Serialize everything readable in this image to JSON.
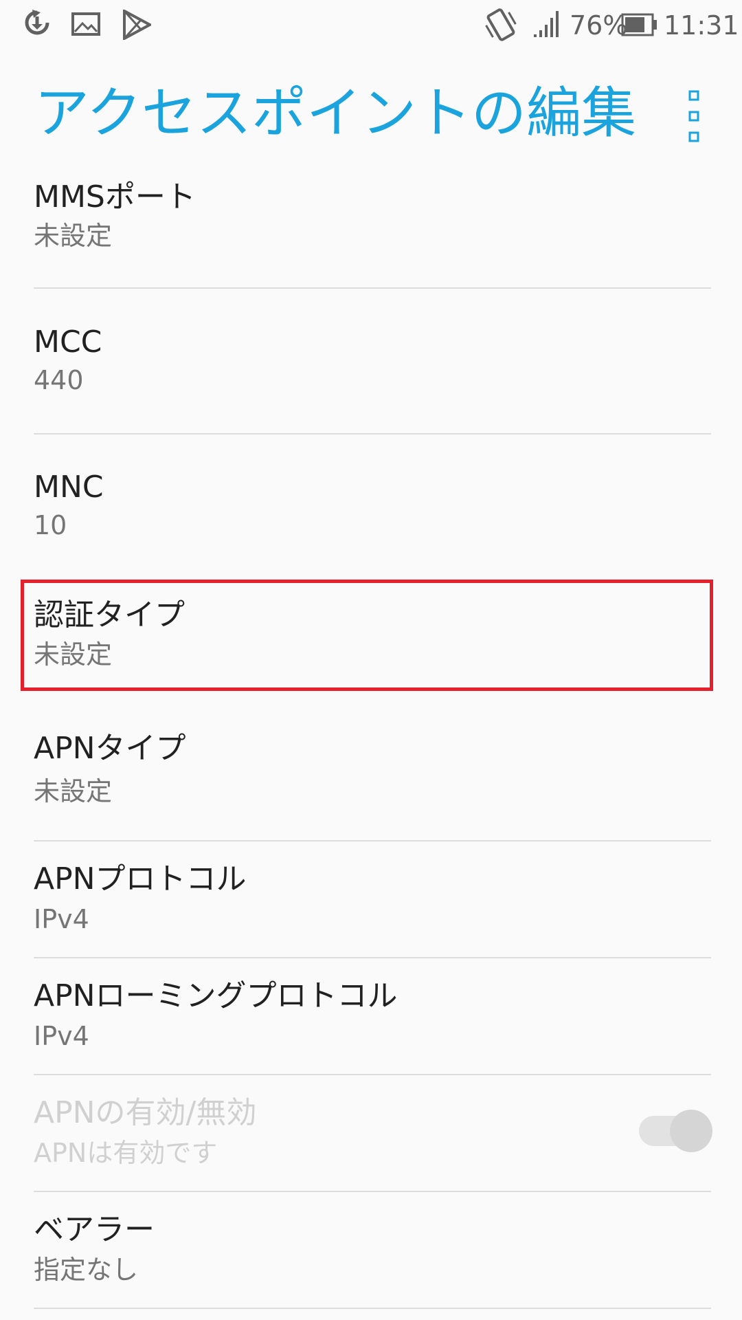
{
  "status_bar": {
    "battery": "76%",
    "time": "11:31",
    "icons": [
      "sync-download-icon",
      "image-icon",
      "play-store-icon",
      "vibrate-icon",
      "signal-icon",
      "battery-icon"
    ]
  },
  "app_bar": {
    "title": "アクセスポイントの編集",
    "menu_icon": "more-vert-icon"
  },
  "settings": {
    "mms_port": {
      "title": "MMSポート",
      "summary": "未設定"
    },
    "mcc": {
      "title": "MCC",
      "summary": "440"
    },
    "mnc": {
      "title": "MNC",
      "summary": "10"
    },
    "auth_type": {
      "title": "認証タイプ",
      "summary": "未設定"
    },
    "apn_type": {
      "title": "APNタイプ",
      "summary": "未設定"
    },
    "apn_protocol": {
      "title": "APNプロトコル",
      "summary": "IPv4"
    },
    "apn_roaming_protocol": {
      "title": "APNローミングプロトコル",
      "summary": "IPv4"
    },
    "apn_enable": {
      "title": "APNの有効/無効",
      "summary": "APNは有効です",
      "enabled": true
    },
    "bearer": {
      "title": "ベアラー",
      "summary": "指定なし"
    }
  },
  "colors": {
    "accent": "#1aa3dd",
    "highlight_border": "#e3202b"
  }
}
